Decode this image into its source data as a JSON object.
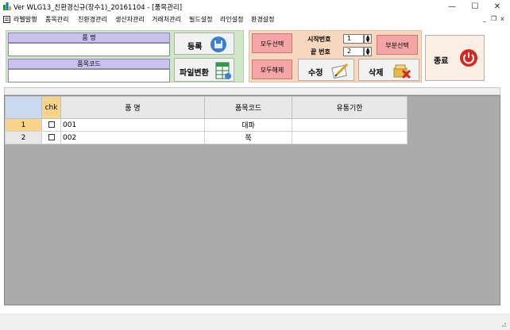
{
  "window": {
    "title": "Ver WLG13_친환경신규(장수1)_20161104 - [품목관리]",
    "minimize": "—",
    "maximize": "☐",
    "close": "✕"
  },
  "menu": {
    "items": [
      "라벨발행",
      "품목관리",
      "친환경관리",
      "생산자관리",
      "거래처관리",
      "필드설정",
      "라인설정",
      "환경설정"
    ],
    "mdi_minimize": "_",
    "mdi_restore": "❐",
    "mdi_close": "x"
  },
  "form": {
    "product_name_label": "품 명",
    "product_name_value": "",
    "product_code_label": "품목코드",
    "product_code_value": ""
  },
  "buttons": {
    "register": "등록",
    "file_convert": "파일변환",
    "select_all": "모두선택",
    "deselect_all": "모두해제",
    "start_no_label": "시작번호",
    "start_no_value": "1",
    "end_no_label": "끝 번호",
    "end_no_value": "2",
    "partial_select": "부분선택",
    "edit": "수정",
    "delete": "삭제",
    "exit": "종료"
  },
  "grid": {
    "headers": [
      "chk",
      "품 명",
      "품목코드",
      "유통기한"
    ],
    "rows": [
      {
        "no": "1",
        "name": "001",
        "code": "대파",
        "expiry": ""
      },
      {
        "no": "2",
        "name": "002",
        "code": "쪽",
        "expiry": ""
      }
    ]
  },
  "colors": {
    "green_panel": "#cfe7c6",
    "peach_panel": "#f8d7bf",
    "pink_button": "#f5a5a5",
    "header_purple": "#c9c2ee",
    "selected_orange": "#f7d48a"
  }
}
